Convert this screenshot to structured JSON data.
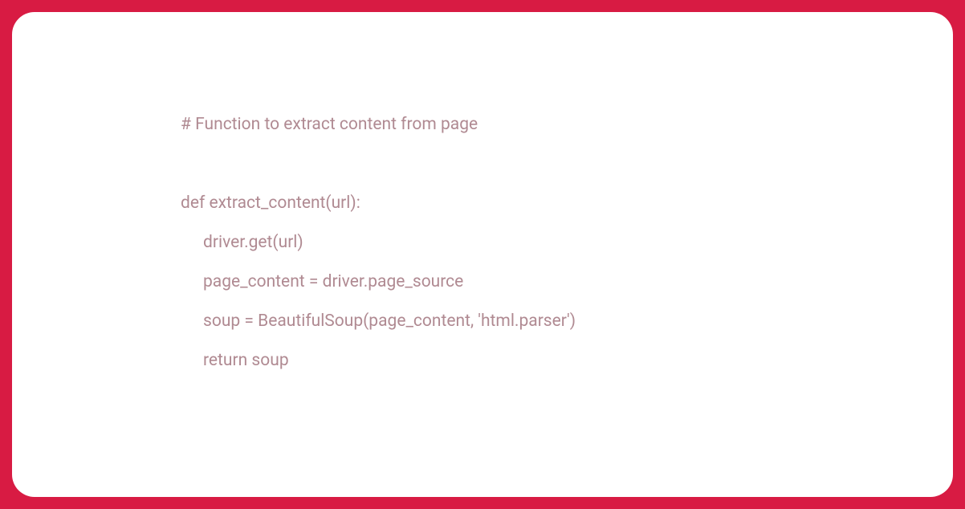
{
  "code": {
    "line1": "# Function to extract content from page",
    "line2": "",
    "line3": "def extract_content(url):",
    "line4": "driver.get(url)",
    "line5": "page_content = driver.page_source",
    "line6": "soup = BeautifulSoup(page_content, 'html.parser')",
    "line7": "return soup"
  },
  "colors": {
    "frame": "#d81b43",
    "card_bg": "#ffffff",
    "code_text": "#b08a92"
  }
}
